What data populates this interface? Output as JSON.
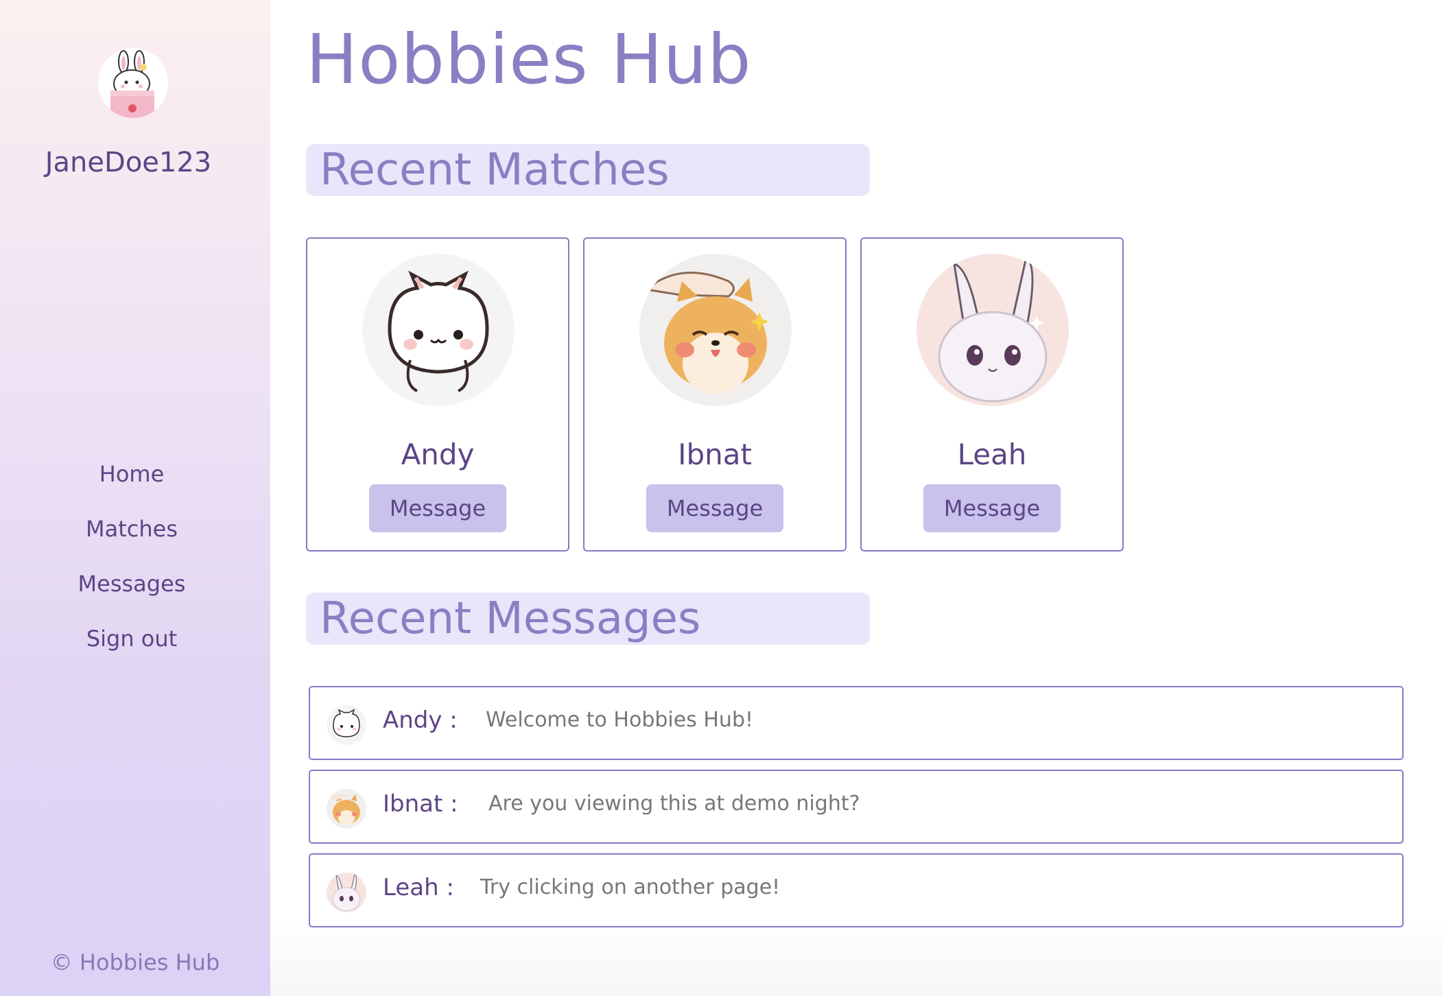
{
  "sidebar": {
    "username": "JaneDoe123",
    "avatar_icon": "bunny-avatar-icon",
    "nav": [
      {
        "label": "Home"
      },
      {
        "label": "Matches"
      },
      {
        "label": "Messages"
      },
      {
        "label": "Sign out"
      }
    ],
    "footer": "© Hobbies Hub"
  },
  "main": {
    "title": "Hobbies Hub",
    "matches_heading": "Recent Matches",
    "messages_heading": "Recent Messages",
    "matches": [
      {
        "name": "Andy",
        "button": "Message",
        "avatar_icon": "white-cat-avatar-icon"
      },
      {
        "name": "Ibnat",
        "button": "Message",
        "avatar_icon": "shiba-dog-avatar-icon"
      },
      {
        "name": "Leah",
        "button": "Message",
        "avatar_icon": "fluffy-bunny-avatar-icon"
      }
    ],
    "messages": [
      {
        "name": "Andy",
        "separator": ":",
        "text": "Welcome to Hobbies Hub!"
      },
      {
        "name": "Ibnat",
        "separator": ":",
        "text": "Are you viewing this at demo night?"
      },
      {
        "name": "Leah",
        "separator": ":",
        "text": "Try clicking on another page!"
      }
    ]
  },
  "colors": {
    "accent": "#8b7fc3",
    "text_dark": "#5b4585",
    "heading_bg": "#ebe5fb",
    "button_bg": "#c9c2ec",
    "border": "#8d76c6"
  }
}
